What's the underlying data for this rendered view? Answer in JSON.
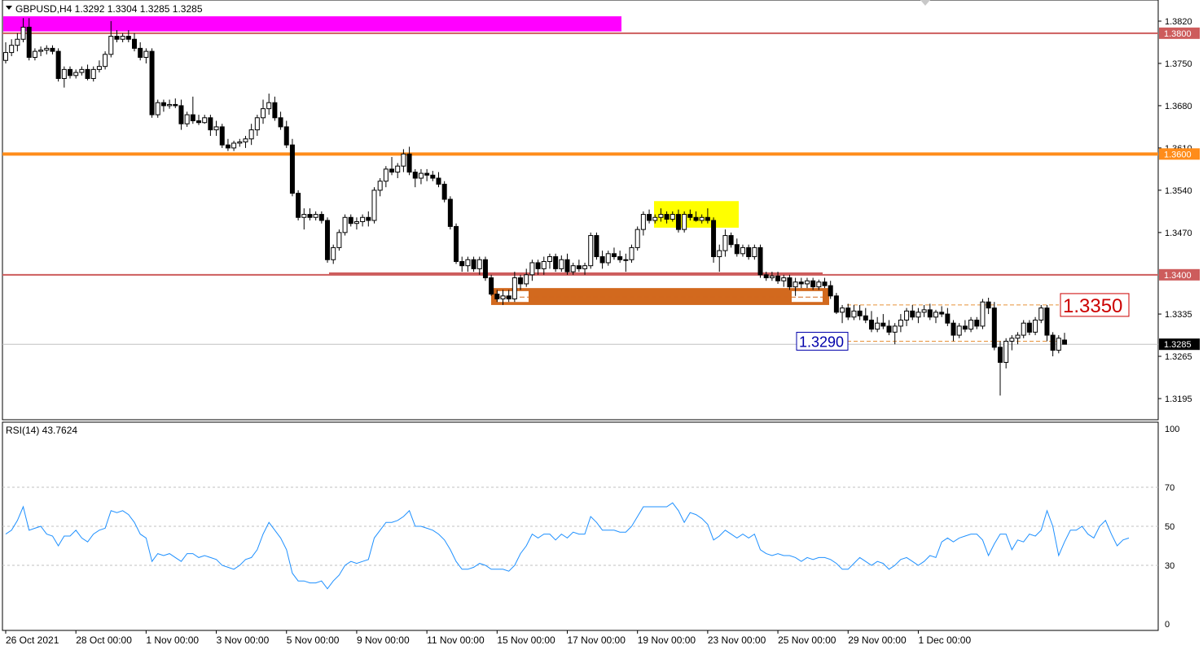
{
  "header": {
    "symbol_label": "GBPUSD,H4  1.3292 1.3304 1.3285 1.3285"
  },
  "rsi_panel": {
    "label": "RSI(14) 43.7624",
    "levels": [
      30,
      50,
      70
    ],
    "ticks": [
      "100",
      "70",
      "50",
      "30",
      "0"
    ]
  },
  "price_axis": {
    "ticks": [
      "1.3820",
      "1.3750",
      "1.3680",
      "1.3610",
      "1.3540",
      "1.3470",
      "1.3335",
      "1.3265",
      "1.3195"
    ]
  },
  "time_axis": {
    "labels": [
      "26 Oct 2021",
      "28 Oct 00:00",
      "1 Nov 00:00",
      "3 Nov 00:00",
      "5 Nov 00:00",
      "9 Nov 00:00",
      "11 Nov 00:00",
      "15 Nov 00:00",
      "17 Nov 00:00",
      "19 Nov 00:00",
      "23 Nov 00:00",
      "25 Nov 00:00",
      "29 Nov 00:00",
      "1 Dec 00:00"
    ]
  },
  "levels": [
    {
      "price": 1.38,
      "label": "1.3800",
      "color": "#cd5c5c"
    },
    {
      "price": 1.36,
      "label": "1.3600",
      "color": "#ff8c1a"
    },
    {
      "price": 1.34,
      "label": "1.3400",
      "color": "#cd5c5c"
    },
    {
      "price": 1.3285,
      "label": "1.3285",
      "color": "#000000"
    }
  ],
  "annotations": {
    "target_upper": "1.3350",
    "target_lower": "1.3290"
  },
  "colors": {
    "magenta_zone": "#ff00ff",
    "yellow_zone": "#ffff00",
    "orange_zone": "#d2691e",
    "rsi_line": "#1e90ff"
  },
  "chart_data": {
    "type": "candlestick",
    "title": "GBPUSD,H4",
    "ylim": [
      1.316,
      1.3855
    ],
    "rsi_ylim": [
      0,
      100
    ],
    "grid": false,
    "ohlc": [
      [
        1.3755,
        1.3785,
        1.375,
        1.3768
      ],
      [
        1.3768,
        1.379,
        1.3762,
        1.378
      ],
      [
        1.378,
        1.38,
        1.377,
        1.379
      ],
      [
        1.379,
        1.3825,
        1.3785,
        1.381
      ],
      [
        1.381,
        1.3825,
        1.3755,
        1.376
      ],
      [
        1.376,
        1.3775,
        1.3755,
        1.377
      ],
      [
        1.377,
        1.3778,
        1.3762,
        1.3772
      ],
      [
        1.3772,
        1.378,
        1.3765,
        1.3775
      ],
      [
        1.3775,
        1.378,
        1.3765,
        1.377
      ],
      [
        1.377,
        1.3775,
        1.372,
        1.3725
      ],
      [
        1.3725,
        1.3745,
        1.371,
        1.374
      ],
      [
        1.374,
        1.3745,
        1.3725,
        1.373
      ],
      [
        1.373,
        1.374,
        1.3725,
        1.3735
      ],
      [
        1.3735,
        1.3745,
        1.373,
        1.374
      ],
      [
        1.374,
        1.3748,
        1.3722,
        1.3725
      ],
      [
        1.3725,
        1.3745,
        1.372,
        1.374
      ],
      [
        1.374,
        1.3755,
        1.3735,
        1.3745
      ],
      [
        1.3745,
        1.377,
        1.374,
        1.3765
      ],
      [
        1.3765,
        1.382,
        1.376,
        1.3795
      ],
      [
        1.3795,
        1.3805,
        1.3785,
        1.379
      ],
      [
        1.379,
        1.38,
        1.3785,
        1.3795
      ],
      [
        1.3795,
        1.3805,
        1.3785,
        1.379
      ],
      [
        1.379,
        1.38,
        1.377,
        1.3775
      ],
      [
        1.3775,
        1.3785,
        1.3755,
        1.376
      ],
      [
        1.376,
        1.3775,
        1.375,
        1.377
      ],
      [
        1.377,
        1.3775,
        1.366,
        1.3665
      ],
      [
        1.3665,
        1.369,
        1.366,
        1.3685
      ],
      [
        1.3685,
        1.369,
        1.367,
        1.368
      ],
      [
        1.368,
        1.369,
        1.3675,
        1.3682
      ],
      [
        1.3682,
        1.3692,
        1.3676,
        1.368
      ],
      [
        1.368,
        1.369,
        1.364,
        1.365
      ],
      [
        1.365,
        1.367,
        1.3645,
        1.3665
      ],
      [
        1.3665,
        1.3695,
        1.365,
        1.3655
      ],
      [
        1.3655,
        1.3665,
        1.3648,
        1.3652
      ],
      [
        1.3652,
        1.3665,
        1.365,
        1.366
      ],
      [
        1.366,
        1.3665,
        1.363,
        1.364
      ],
      [
        1.364,
        1.3655,
        1.363,
        1.3645
      ],
      [
        1.3645,
        1.365,
        1.361,
        1.3615
      ],
      [
        1.3615,
        1.3625,
        1.3605,
        1.361
      ],
      [
        1.361,
        1.3622,
        1.3605,
        1.3618
      ],
      [
        1.3618,
        1.3625,
        1.3612,
        1.362
      ],
      [
        1.362,
        1.363,
        1.361,
        1.3625
      ],
      [
        1.3625,
        1.365,
        1.3615,
        1.364
      ],
      [
        1.364,
        1.3665,
        1.363,
        1.366
      ],
      [
        1.366,
        1.369,
        1.365,
        1.3675
      ],
      [
        1.3675,
        1.37,
        1.3665,
        1.3685
      ],
      [
        1.3685,
        1.3695,
        1.3655,
        1.366
      ],
      [
        1.366,
        1.367,
        1.364,
        1.3645
      ],
      [
        1.3645,
        1.3655,
        1.361,
        1.3615
      ],
      [
        1.3615,
        1.3625,
        1.353,
        1.3535
      ],
      [
        1.3535,
        1.354,
        1.349,
        1.3495
      ],
      [
        1.3495,
        1.351,
        1.3475,
        1.35
      ],
      [
        1.35,
        1.351,
        1.349,
        1.3495
      ],
      [
        1.3495,
        1.3505,
        1.349,
        1.35
      ],
      [
        1.35,
        1.3505,
        1.3485,
        1.349
      ],
      [
        1.349,
        1.3495,
        1.342,
        1.3425
      ],
      [
        1.3425,
        1.345,
        1.3418,
        1.3445
      ],
      [
        1.3445,
        1.3475,
        1.344,
        1.347
      ],
      [
        1.347,
        1.35,
        1.3465,
        1.3495
      ],
      [
        1.3495,
        1.35,
        1.348,
        1.3485
      ],
      [
        1.3485,
        1.3495,
        1.3475,
        1.3488
      ],
      [
        1.3488,
        1.35,
        1.348,
        1.3495
      ],
      [
        1.3495,
        1.3505,
        1.348,
        1.349
      ],
      [
        1.349,
        1.3545,
        1.3485,
        1.354
      ],
      [
        1.354,
        1.356,
        1.353,
        1.3555
      ],
      [
        1.3555,
        1.358,
        1.3545,
        1.3575
      ],
      [
        1.3575,
        1.3595,
        1.3565,
        1.357
      ],
      [
        1.357,
        1.3585,
        1.356,
        1.358
      ],
      [
        1.358,
        1.3608,
        1.357,
        1.36
      ],
      [
        1.36,
        1.3612,
        1.3565,
        1.357
      ],
      [
        1.357,
        1.3575,
        1.3545,
        1.356
      ],
      [
        1.356,
        1.3575,
        1.355,
        1.3568
      ],
      [
        1.3568,
        1.3575,
        1.3555,
        1.3565
      ],
      [
        1.3565,
        1.3572,
        1.3555,
        1.356
      ],
      [
        1.356,
        1.357,
        1.3545,
        1.355
      ],
      [
        1.355,
        1.3555,
        1.352,
        1.3525
      ],
      [
        1.3525,
        1.353,
        1.3475,
        1.348
      ],
      [
        1.348,
        1.3485,
        1.3418,
        1.3422
      ],
      [
        1.3422,
        1.343,
        1.3405,
        1.3415
      ],
      [
        1.3415,
        1.343,
        1.3405,
        1.3425
      ],
      [
        1.3425,
        1.343,
        1.3405,
        1.341
      ],
      [
        1.341,
        1.343,
        1.34,
        1.3425
      ],
      [
        1.3425,
        1.343,
        1.339,
        1.3395
      ],
      [
        1.3395,
        1.34,
        1.3365,
        1.3368
      ],
      [
        1.3368,
        1.3375,
        1.3355,
        1.336
      ],
      [
        1.336,
        1.3375,
        1.335,
        1.3365
      ],
      [
        1.3365,
        1.3375,
        1.3355,
        1.336
      ],
      [
        1.336,
        1.3405,
        1.3355,
        1.3395
      ],
      [
        1.3395,
        1.34,
        1.3375,
        1.3385
      ],
      [
        1.3385,
        1.341,
        1.338,
        1.34
      ],
      [
        1.34,
        1.3425,
        1.339,
        1.342
      ],
      [
        1.342,
        1.3425,
        1.34,
        1.341
      ],
      [
        1.341,
        1.343,
        1.34,
        1.3422
      ],
      [
        1.3422,
        1.3435,
        1.341,
        1.343
      ],
      [
        1.343,
        1.3435,
        1.3405,
        1.341
      ],
      [
        1.341,
        1.3432,
        1.3405,
        1.3425
      ],
      [
        1.3425,
        1.3435,
        1.34,
        1.3405
      ],
      [
        1.3405,
        1.342,
        1.34,
        1.3415
      ],
      [
        1.3415,
        1.3425,
        1.3405,
        1.341
      ],
      [
        1.341,
        1.342,
        1.34,
        1.3415
      ],
      [
        1.3415,
        1.347,
        1.341,
        1.3465
      ],
      [
        1.3465,
        1.347,
        1.3425,
        1.343
      ],
      [
        1.343,
        1.344,
        1.341,
        1.342
      ],
      [
        1.342,
        1.344,
        1.3415,
        1.3435
      ],
      [
        1.3435,
        1.3445,
        1.3425,
        1.343
      ],
      [
        1.343,
        1.344,
        1.342,
        1.3425
      ],
      [
        1.3425,
        1.3435,
        1.3405,
        1.3425
      ],
      [
        1.3425,
        1.345,
        1.342,
        1.3445
      ],
      [
        1.3445,
        1.348,
        1.344,
        1.3475
      ],
      [
        1.3475,
        1.3505,
        1.3465,
        1.35
      ],
      [
        1.35,
        1.3508,
        1.3485,
        1.349
      ],
      [
        1.349,
        1.35,
        1.3485,
        1.3495
      ],
      [
        1.3495,
        1.351,
        1.3488,
        1.35
      ],
      [
        1.35,
        1.3505,
        1.3485,
        1.3492
      ],
      [
        1.3492,
        1.3505,
        1.3488,
        1.35
      ],
      [
        1.35,
        1.3508,
        1.347,
        1.3475
      ],
      [
        1.3475,
        1.3505,
        1.347,
        1.35
      ],
      [
        1.35,
        1.3508,
        1.349,
        1.3495
      ],
      [
        1.3495,
        1.3505,
        1.3488,
        1.349
      ],
      [
        1.349,
        1.35,
        1.3485,
        1.3495
      ],
      [
        1.3495,
        1.351,
        1.3485,
        1.349
      ],
      [
        1.349,
        1.3495,
        1.342,
        1.343
      ],
      [
        1.343,
        1.345,
        1.3405,
        1.344
      ],
      [
        1.344,
        1.3475,
        1.343,
        1.3465
      ],
      [
        1.3465,
        1.347,
        1.3445,
        1.345
      ],
      [
        1.345,
        1.346,
        1.343,
        1.3435
      ],
      [
        1.3435,
        1.345,
        1.343,
        1.3445
      ],
      [
        1.3445,
        1.345,
        1.3425,
        1.343
      ],
      [
        1.343,
        1.345,
        1.3425,
        1.3445
      ],
      [
        1.3445,
        1.345,
        1.3395,
        1.34
      ],
      [
        1.34,
        1.3405,
        1.339,
        1.3395
      ],
      [
        1.3395,
        1.3405,
        1.339,
        1.3398
      ],
      [
        1.3398,
        1.3405,
        1.3385,
        1.339
      ],
      [
        1.339,
        1.34,
        1.338,
        1.3395
      ],
      [
        1.3395,
        1.34,
        1.3375,
        1.338
      ],
      [
        1.338,
        1.3395,
        1.3365,
        1.3388
      ],
      [
        1.3388,
        1.3395,
        1.3378,
        1.3385
      ],
      [
        1.3385,
        1.3395,
        1.3378,
        1.339
      ],
      [
        1.339,
        1.3395,
        1.3375,
        1.338
      ],
      [
        1.338,
        1.3392,
        1.3375,
        1.3388
      ],
      [
        1.3388,
        1.3395,
        1.3378,
        1.3382
      ],
      [
        1.3382,
        1.339,
        1.336,
        1.3365
      ],
      [
        1.3365,
        1.337,
        1.3335,
        1.3338
      ],
      [
        1.3338,
        1.335,
        1.332,
        1.3345
      ],
      [
        1.3345,
        1.3352,
        1.3325,
        1.333
      ],
      [
        1.333,
        1.335,
        1.3325,
        1.334
      ],
      [
        1.334,
        1.335,
        1.3325,
        1.3332
      ],
      [
        1.3332,
        1.3345,
        1.332,
        1.3325
      ],
      [
        1.3325,
        1.334,
        1.3305,
        1.331
      ],
      [
        1.331,
        1.333,
        1.3305,
        1.332
      ],
      [
        1.332,
        1.3335,
        1.331,
        1.3315
      ],
      [
        1.3315,
        1.3325,
        1.33,
        1.3305
      ],
      [
        1.3305,
        1.332,
        1.3285,
        1.3315
      ],
      [
        1.3315,
        1.3335,
        1.3305,
        1.3325
      ],
      [
        1.3325,
        1.3345,
        1.3315,
        1.334
      ],
      [
        1.334,
        1.335,
        1.3325,
        1.333
      ],
      [
        1.333,
        1.3345,
        1.332,
        1.3338
      ],
      [
        1.3338,
        1.335,
        1.333,
        1.3342
      ],
      [
        1.3342,
        1.3352,
        1.3325,
        1.333
      ],
      [
        1.333,
        1.3342,
        1.332,
        1.3338
      ],
      [
        1.3338,
        1.3348,
        1.333,
        1.3335
      ],
      [
        1.3335,
        1.3345,
        1.3315,
        1.332
      ],
      [
        1.332,
        1.3325,
        1.329,
        1.33
      ],
      [
        1.33,
        1.332,
        1.3295,
        1.3315
      ],
      [
        1.3315,
        1.3325,
        1.3305,
        1.331
      ],
      [
        1.331,
        1.333,
        1.3305,
        1.3325
      ],
      [
        1.3325,
        1.333,
        1.331,
        1.3315
      ],
      [
        1.3315,
        1.336,
        1.331,
        1.3355
      ],
      [
        1.3355,
        1.3362,
        1.3335,
        1.3345
      ],
      [
        1.3345,
        1.3355,
        1.3275,
        1.328
      ],
      [
        1.328,
        1.329,
        1.32,
        1.3255
      ],
      [
        1.3255,
        1.3295,
        1.3245,
        1.329
      ],
      [
        1.329,
        1.33,
        1.3275,
        1.3295
      ],
      [
        1.3295,
        1.3305,
        1.3285,
        1.33
      ],
      [
        1.33,
        1.3325,
        1.3295,
        1.332
      ],
      [
        1.332,
        1.3325,
        1.33,
        1.3305
      ],
      [
        1.3305,
        1.333,
        1.33,
        1.3325
      ],
      [
        1.3325,
        1.335,
        1.332,
        1.3345
      ],
      [
        1.3345,
        1.335,
        1.329,
        1.33
      ],
      [
        1.33,
        1.3305,
        1.3265,
        1.3275
      ],
      [
        1.3275,
        1.33,
        1.327,
        1.3295
      ],
      [
        1.3292,
        1.3304,
        1.3285,
        1.3285
      ]
    ],
    "rsi": [
      46,
      48,
      53,
      60,
      48,
      49,
      50,
      46,
      45,
      40,
      45,
      45,
      48,
      44,
      42,
      46,
      48,
      49,
      58,
      57,
      58,
      56,
      52,
      46,
      44,
      32,
      36,
      35,
      36,
      34,
      32,
      36,
      36,
      34,
      35,
      34,
      33,
      30,
      29,
      28,
      30,
      33,
      34,
      38,
      46,
      52,
      48,
      44,
      38,
      26,
      22,
      22,
      21,
      21,
      22,
      18,
      22,
      25,
      30,
      32,
      31,
      32,
      33,
      44,
      48,
      52,
      52,
      53,
      55,
      58,
      50,
      50,
      49,
      48,
      46,
      43,
      38,
      32,
      28,
      28,
      29,
      31,
      30,
      28,
      28,
      28,
      27,
      30,
      36,
      40,
      46,
      44,
      46,
      46,
      43,
      46,
      44,
      47,
      46,
      46,
      55,
      52,
      48,
      48,
      48,
      47,
      47,
      50,
      55,
      60,
      60,
      60,
      60,
      60,
      62,
      58,
      52,
      57,
      56,
      54,
      51,
      43,
      45,
      48,
      46,
      44,
      46,
      44,
      46,
      38,
      36,
      35,
      36,
      35,
      35,
      34,
      32,
      34,
      33,
      34,
      34,
      33,
      31,
      28,
      28,
      31,
      34,
      32,
      30,
      32,
      31,
      28,
      30,
      33,
      34,
      32,
      30,
      32,
      35,
      34,
      42,
      44,
      42,
      44,
      45,
      46,
      46,
      43,
      35,
      41,
      46,
      46,
      38,
      43,
      42,
      46,
      45,
      48,
      58,
      50,
      35,
      42,
      48,
      48,
      50,
      46,
      44,
      50,
      53,
      46,
      40,
      43,
      44
    ]
  }
}
